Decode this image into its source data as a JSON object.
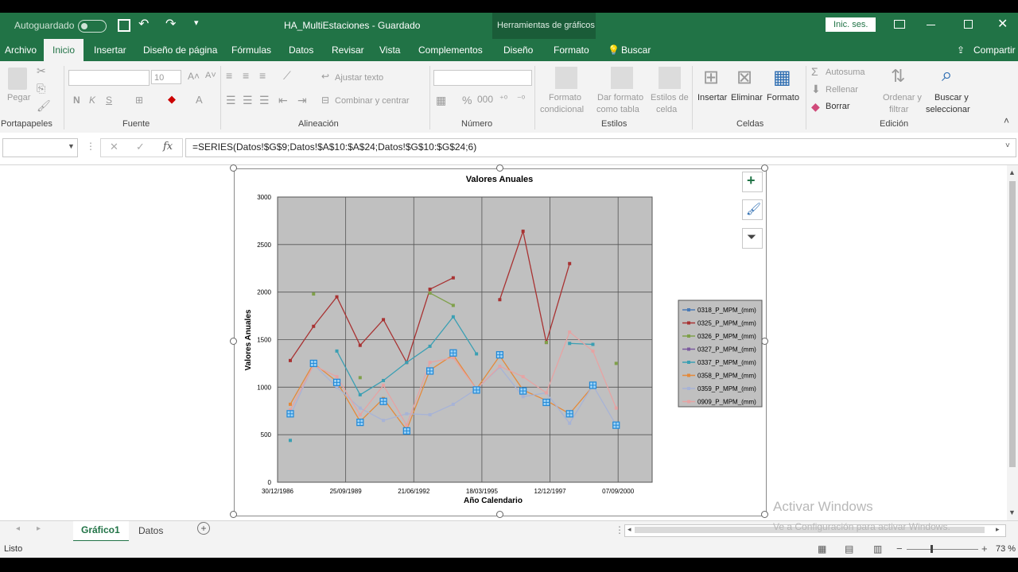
{
  "app": {
    "autosave_label": "Autoguardado",
    "title": "HA_MultiEstaciones  -  Guardado",
    "context_tab_title": "Herramientas de gráficos",
    "signin": "Inic. ses."
  },
  "menu": {
    "items": [
      "Archivo",
      "Inicio",
      "Insertar",
      "Diseño de página",
      "Fórmulas",
      "Datos",
      "Revisar",
      "Vista",
      "Complementos",
      "Diseño",
      "Formato"
    ],
    "search": "Buscar",
    "share": "Compartir"
  },
  "ribbon": {
    "groups": [
      "Portapapeles",
      "Fuente",
      "Alineación",
      "Número",
      "Estilos",
      "Celdas",
      "Edición"
    ],
    "paste": "Pegar",
    "font_size": "10",
    "wrap_text": "Ajustar texto",
    "merge_center": "Combinar y centrar",
    "cond_format_1": "Formato",
    "cond_format_2": "condicional",
    "table_format_1": "Dar formato",
    "table_format_2": "como tabla",
    "cell_styles_1": "Estilos de",
    "cell_styles_2": "celda",
    "insert": "Insertar",
    "delete": "Eliminar",
    "format": "Formato",
    "autosum": "Autosuma",
    "fill": "Rellenar",
    "clear": "Borrar",
    "sort_1": "Ordenar y",
    "sort_2": "filtrar",
    "find_1": "Buscar y",
    "find_2": "seleccionar"
  },
  "formula_bar": {
    "fx": "fx",
    "formula": "=SERIES(Datos!$G$9;Datos!$A$10:$A$24;Datos!$G$10:$G$24;6)"
  },
  "sheet_tabs": {
    "tabs": [
      "Gráfico1",
      "Datos"
    ],
    "active": "Gráfico1"
  },
  "status": {
    "ready": "Listo",
    "zoom": "73 %"
  },
  "watermark": {
    "line1": "Activar Windows",
    "line2": "Ve a Configuración para activar Windows."
  },
  "colors": {
    "excel_green": "#217346",
    "plot_bg": "#c0c0c0"
  },
  "chart_data": {
    "type": "line",
    "title": "Valores Anuales",
    "xlabel": "Año Calendario",
    "ylabel": "Valores Anuales",
    "ylim": [
      0,
      3000
    ],
    "yticks": [
      0,
      500,
      1000,
      1500,
      2000,
      2500,
      3000
    ],
    "x_tick_labels": [
      "30/12/1986",
      "25/09/1989",
      "21/06/1992",
      "18/03/1995",
      "12/12/1997",
      "07/09/2000"
    ],
    "x": [
      "1986",
      "1987",
      "1988",
      "1989",
      "1990",
      "1991",
      "1992",
      "1993",
      "1994",
      "1995",
      "1996",
      "1997",
      "1998",
      "1999",
      "2000",
      "2001"
    ],
    "grid": true,
    "legend_position": "right",
    "series": [
      {
        "name": "0318_P_MPM_(mm)",
        "color": "#4a7ab5",
        "values": [
          null,
          null,
          null,
          null,
          null,
          null,
          null,
          null,
          null,
          null,
          null,
          null,
          null,
          null,
          null,
          null
        ]
      },
      {
        "name": "0325_P_MPM_(mm)",
        "color": "#a83232",
        "values": [
          1280,
          1640,
          1950,
          1440,
          1710,
          1260,
          2030,
          2150,
          null,
          1920,
          2640,
          1470,
          2300,
          null,
          null,
          null
        ]
      },
      {
        "name": "0326_P_MPM_(mm)",
        "color": "#7fa04a",
        "values": [
          null,
          1980,
          null,
          1100,
          null,
          null,
          1990,
          1860,
          null,
          null,
          null,
          1470,
          null,
          null,
          1250,
          null
        ]
      },
      {
        "name": "0327_P_MPM_(mm)",
        "color": "#7b5a9e",
        "values": [
          null,
          null,
          null,
          null,
          null,
          null,
          null,
          null,
          null,
          null,
          null,
          null,
          null,
          null,
          null,
          null
        ]
      },
      {
        "name": "0337_P_MPM_(mm)",
        "color": "#3a9fb3",
        "values": [
          440,
          null,
          1380,
          920,
          1070,
          1260,
          1430,
          1740,
          1350,
          null,
          null,
          null,
          1460,
          1450,
          null,
          null
        ]
      },
      {
        "name": "0358_P_MPM_(mm)",
        "color": "#e48a3a",
        "values": [
          820,
          1250,
          1060,
          640,
          880,
          550,
          1180,
          1340,
          980,
          1330,
          970,
          860,
          720,
          1010,
          null,
          null
        ]
      },
      {
        "name": "0359_P_MPM_(mm)",
        "color": "#a7b3d6",
        "values": [
          700,
          1240,
          1000,
          780,
          650,
          720,
          710,
          820,
          980,
          1210,
          900,
          940,
          620,
          1020,
          600,
          null
        ]
      },
      {
        "name": "0909_P_MPM_(mm)",
        "color": "#e6a3a3",
        "values": [
          760,
          1230,
          1110,
          710,
          1020,
          600,
          1260,
          1310,
          980,
          1220,
          1110,
          940,
          1580,
          1380,
          780,
          null
        ]
      }
    ],
    "highlighted_series": {
      "name": "0358_P_MPM_(mm)",
      "values": [
        720,
        1250,
        1050,
        630,
        850,
        540,
        1170,
        1360,
        970,
        1340,
        960,
        840,
        720,
        1020,
        600,
        null
      ]
    }
  }
}
